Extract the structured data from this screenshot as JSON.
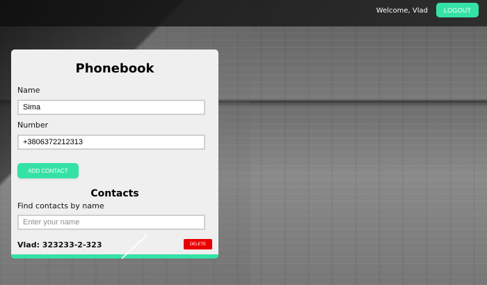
{
  "header": {
    "welcome_text": "Welcome, Vlad",
    "logout_label": "LOGOUT"
  },
  "phonebook": {
    "title": "Phonebook",
    "name_label": "Name",
    "name_value": "Sima",
    "number_label": "Number",
    "number_value": "+3806372212313",
    "add_contact_label": "ADD CONTACT",
    "contacts_title": "Contacts",
    "search_label": "Find contacts by name",
    "search_placeholder": "Enter your name",
    "contacts": [
      {
        "text": "Vlad: 323233-2-323",
        "delete_label": "DELETE"
      }
    ]
  },
  "colors": {
    "accent": "#35e2a5",
    "danger": "#e90000",
    "card_background": "#efefef"
  }
}
